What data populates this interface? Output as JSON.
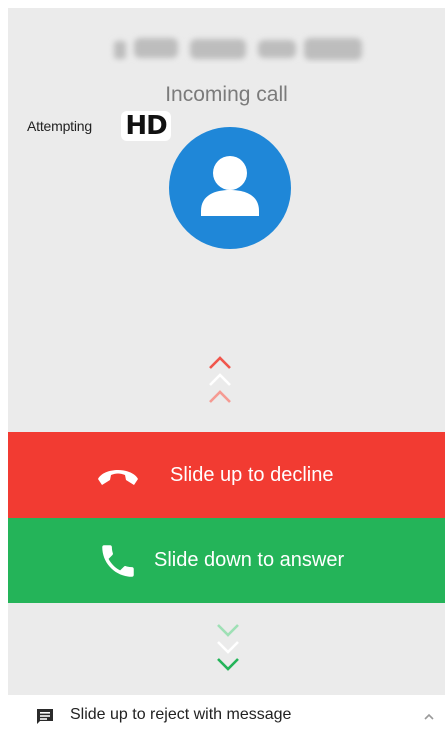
{
  "header": {
    "incoming_label": "Incoming call",
    "attempting_label": "Attempting",
    "hd_label": "HD"
  },
  "actions": {
    "decline_label": "Slide up to decline",
    "answer_label": "Slide down to answer"
  },
  "message_row": {
    "label": "Slide up to reject with message"
  },
  "colors": {
    "background": "#ebebeb",
    "avatar": "#1f87d8",
    "decline": "#f23b32",
    "answer": "#24b459",
    "chevron_up": "#f0564c",
    "chevron_down": "#24b459"
  },
  "icons": {
    "avatar": "person-icon",
    "decline": "hangup-icon",
    "answer": "phone-icon",
    "message": "message-icon",
    "expand": "chevron-up-icon"
  }
}
